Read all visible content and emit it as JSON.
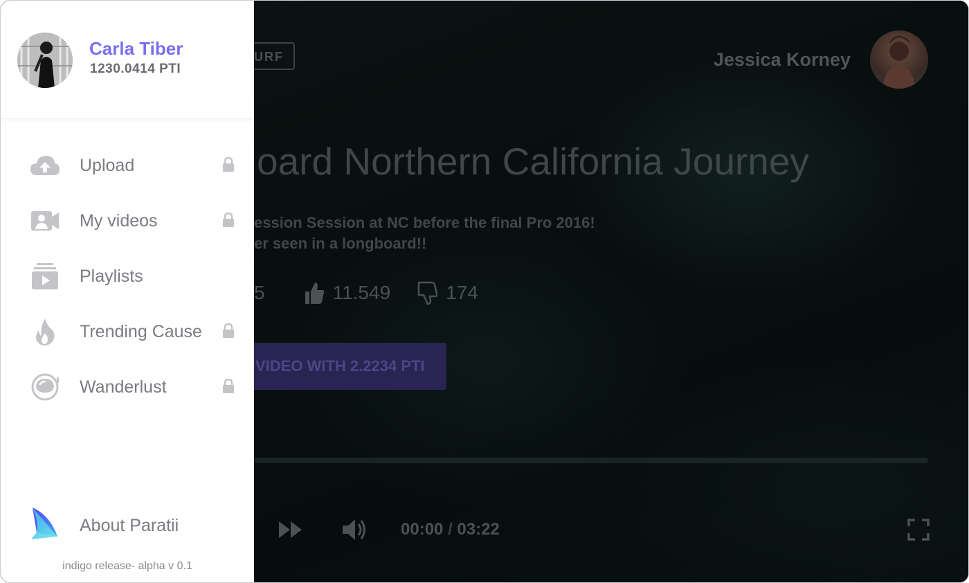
{
  "user": {
    "name": "Carla Tiber",
    "balance": "1230.0414 PTI"
  },
  "sidebar": {
    "items": [
      {
        "label": "Upload",
        "icon": "cloud-upload-icon",
        "locked": true
      },
      {
        "label": "My videos",
        "icon": "video-camera-icon",
        "locked": true
      },
      {
        "label": "Playlists",
        "icon": "playlist-icon",
        "locked": false
      },
      {
        "label": "Trending Cause",
        "icon": "flame-icon",
        "locked": true
      },
      {
        "label": "Wanderlust",
        "icon": "astronaut-helmet-icon",
        "locked": true
      }
    ],
    "about_label": "About Paratii",
    "version": "indigo release- alpha v 0.1"
  },
  "video": {
    "tag": "URF",
    "creator": "Jessica Korney",
    "title": "oard Northern California Journey",
    "description_line1": "ession Session at NC before the final Pro 2016!",
    "description_line2": "er seen in a longboard!!",
    "views_partial": "5",
    "likes": "11.549",
    "dislikes": "174",
    "buy_label": "VIDEO WITH 2.2234 PTI",
    "time_current": "00:00",
    "time_separator": "/",
    "time_total": "03:22",
    "progress_fraction": 0
  },
  "colors": {
    "accent": "#7a6ff0",
    "sidebar_text": "#7b7b82",
    "button": "#2a2453"
  }
}
